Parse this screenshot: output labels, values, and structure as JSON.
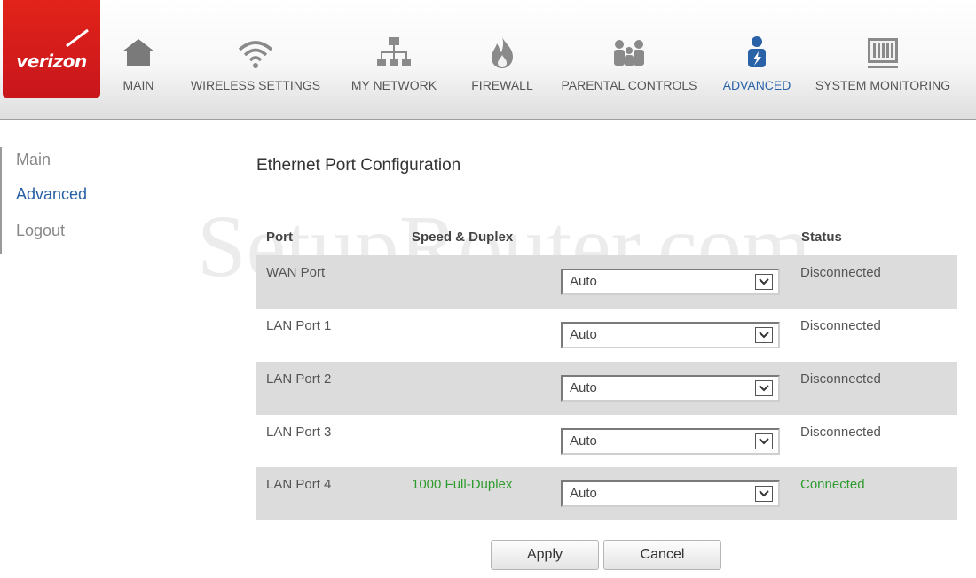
{
  "brand": {
    "logo_text": "verizon",
    "color": "#d52b1e"
  },
  "nav": [
    {
      "label": "MAIN",
      "icon": "house-icon"
    },
    {
      "label": "WIRELESS SETTINGS",
      "icon": "wifi-icon"
    },
    {
      "label": "MY NETWORK",
      "icon": "network-icon"
    },
    {
      "label": "FIREWALL",
      "icon": "flame-icon"
    },
    {
      "label": "PARENTAL CONTROLS",
      "icon": "family-icon"
    },
    {
      "label": "ADVANCED",
      "icon": "advanced-user-icon",
      "active": true
    },
    {
      "label": "SYSTEM MONITORING",
      "icon": "monitor-icon"
    }
  ],
  "sidebar": {
    "items": [
      {
        "label": "Main"
      },
      {
        "label": "Advanced",
        "active": true
      },
      {
        "label": "Logout"
      }
    ]
  },
  "page": {
    "title": "Ethernet Port Configuration"
  },
  "watermark": "SetupRouter.com",
  "table": {
    "headers": {
      "port": "Port",
      "speed": "Speed & Duplex",
      "status": "Status"
    },
    "rows": [
      {
        "port": "WAN Port",
        "speed": "",
        "mode": "Auto",
        "status": "Disconnected"
      },
      {
        "port": "LAN Port 1",
        "speed": "",
        "mode": "Auto",
        "status": "Disconnected"
      },
      {
        "port": "LAN Port 2",
        "speed": "",
        "mode": "Auto",
        "status": "Disconnected"
      },
      {
        "port": "LAN Port 3",
        "speed": "",
        "mode": "Auto",
        "status": "Disconnected"
      },
      {
        "port": "LAN Port 4",
        "speed": "1000 Full-Duplex",
        "mode": "Auto",
        "status": "Connected"
      }
    ]
  },
  "buttons": {
    "apply": "Apply",
    "cancel": "Cancel"
  },
  "colors": {
    "accent": "#2a62a8",
    "connected": "#2e9b2e",
    "row_shade": "#dcdcdc"
  }
}
